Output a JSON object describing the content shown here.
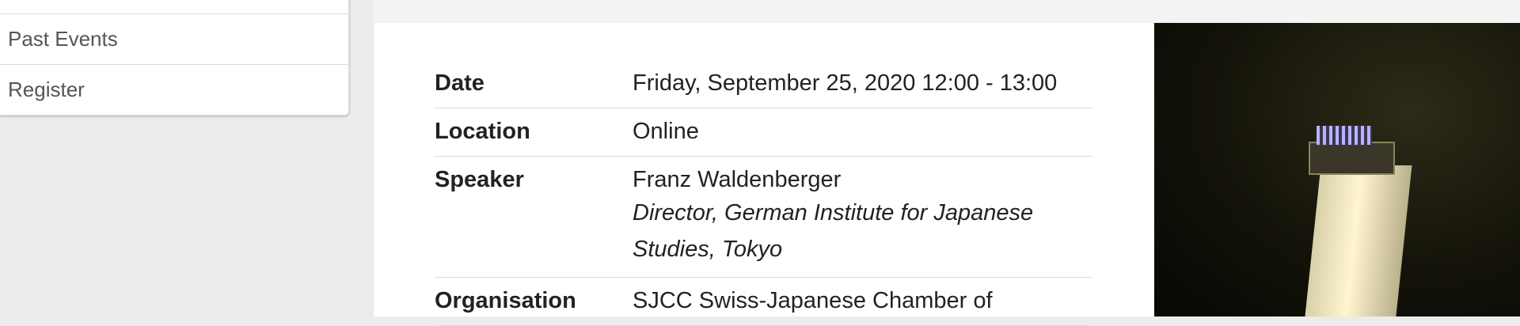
{
  "sidebar": {
    "items": [
      {
        "label": "Past Events"
      },
      {
        "label": "Register"
      }
    ]
  },
  "event": {
    "rows": [
      {
        "label": "Date",
        "value": "Friday, September 25, 2020 12:00 - 13:00"
      },
      {
        "label": "Location",
        "value": "Online"
      },
      {
        "label": "Speaker",
        "name": "Franz Waldenberger",
        "role": "Director, German Institute for Japanese Studies, Tokyo"
      },
      {
        "label": "Organisation",
        "value": "SJCC Swiss-Japanese Chamber of"
      }
    ]
  }
}
